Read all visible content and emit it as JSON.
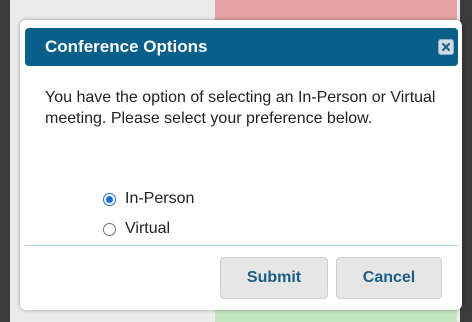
{
  "dialog": {
    "title": "Conference Options",
    "close_icon": "close-icon",
    "message": "You have the option of selecting an In-Person or Virtual meeting. Please select your preference below.",
    "options": [
      {
        "label": "In-Person",
        "checked": true
      },
      {
        "label": "Virtual",
        "checked": false
      }
    ],
    "submit_label": "Submit",
    "cancel_label": "Cancel"
  },
  "colors": {
    "titlebar": "#075f8a",
    "button_text": "#1d5e86",
    "radio_selected": "#1a6fd3"
  }
}
